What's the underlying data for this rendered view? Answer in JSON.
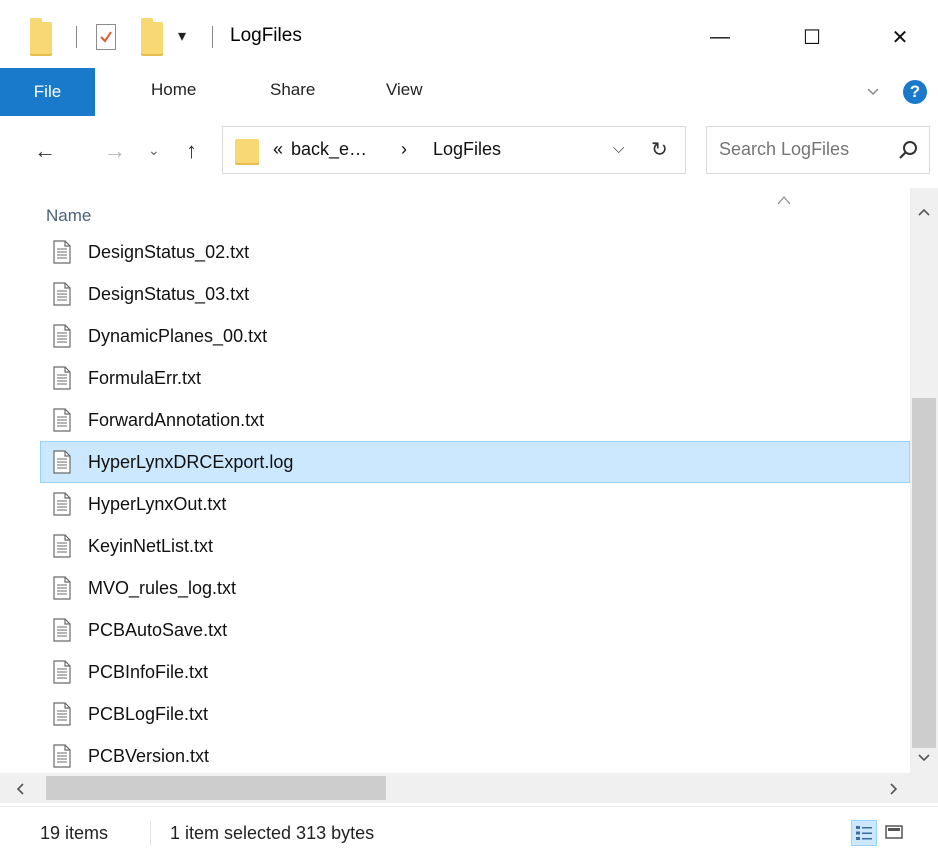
{
  "window": {
    "title": "LogFiles",
    "minimize_symbol": "—",
    "maximize_symbol": "☐",
    "close_symbol": "✕"
  },
  "ribbon": {
    "tabs": [
      {
        "label": "File",
        "active": true
      },
      {
        "label": "Home"
      },
      {
        "label": "Share"
      },
      {
        "label": "View"
      }
    ],
    "help_symbol": "?"
  },
  "address": {
    "overflow": "«",
    "crumbs": [
      "back_e…",
      "LogFiles"
    ],
    "separator": "›"
  },
  "search": {
    "placeholder": "Search LogFiles"
  },
  "list": {
    "column_header": "Name",
    "items": [
      {
        "name": "DesignStatus_02.txt"
      },
      {
        "name": "DesignStatus_03.txt"
      },
      {
        "name": "DynamicPlanes_00.txt"
      },
      {
        "name": "FormulaErr.txt"
      },
      {
        "name": "ForwardAnnotation.txt"
      },
      {
        "name": "HyperLynxDRCExport.log",
        "selected": true
      },
      {
        "name": "HyperLynxOut.txt"
      },
      {
        "name": "KeyinNetList.txt"
      },
      {
        "name": "MVO_rules_log.txt"
      },
      {
        "name": "PCBAutoSave.txt"
      },
      {
        "name": "PCBInfoFile.txt"
      },
      {
        "name": "PCBLogFile.txt"
      },
      {
        "name": "PCBVersion.txt"
      }
    ]
  },
  "status": {
    "item_count": "19 items",
    "selection": "1 item selected  313 bytes"
  },
  "colors": {
    "accent": "#1979ca",
    "selection_bg": "#cce8ff",
    "selection_border": "#99d1ff",
    "folder": "#f8d775"
  }
}
